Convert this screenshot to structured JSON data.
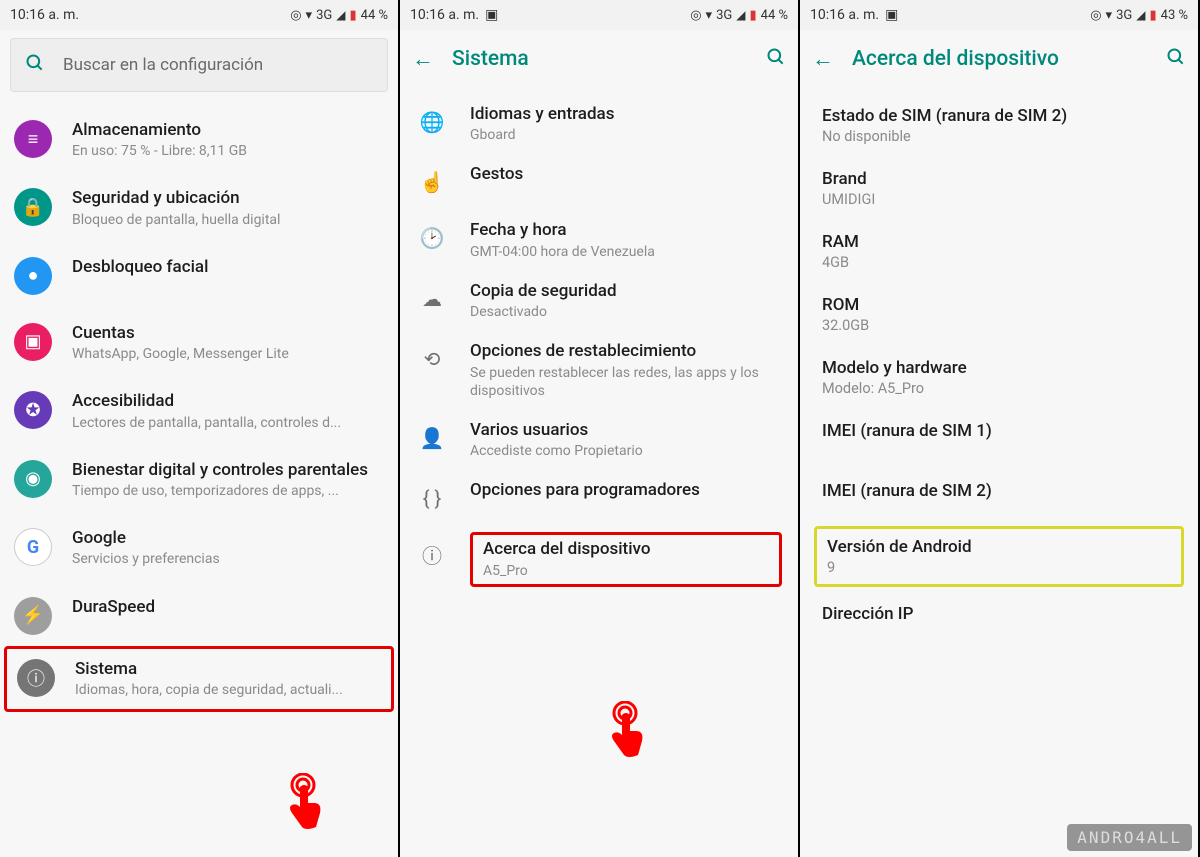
{
  "status": {
    "time1": "10:16 a. m.",
    "time2": "10:16 a. m.",
    "time3": "10:16 a. m.",
    "net": "3G",
    "batt1": "44 %",
    "batt2": "44 %",
    "batt3": "43 %"
  },
  "screen1": {
    "search_placeholder": "Buscar en la configuración",
    "items": [
      {
        "title": "Almacenamiento",
        "sub": "En uso: 75 % - Libre: 8,11 GB"
      },
      {
        "title": "Seguridad y ubicación",
        "sub": "Bloqueo de pantalla, huella digital"
      },
      {
        "title": "Desbloqueo facial",
        "sub": ""
      },
      {
        "title": "Cuentas",
        "sub": "WhatsApp, Google, Messenger Lite"
      },
      {
        "title": "Accesibilidad",
        "sub": "Lectores de pantalla, pantalla, controles d..."
      },
      {
        "title": "Bienestar digital y controles parentales",
        "sub": "Tiempo de uso, temporizadores de apps, ..."
      },
      {
        "title": "Google",
        "sub": "Servicios y preferencias"
      },
      {
        "title": "DuraSpeed",
        "sub": ""
      },
      {
        "title": "Sistema",
        "sub": "Idiomas, hora, copia de seguridad, actuali..."
      }
    ]
  },
  "screen2": {
    "header": "Sistema",
    "items": [
      {
        "title": "Idiomas y entradas",
        "sub": "Gboard"
      },
      {
        "title": "Gestos",
        "sub": ""
      },
      {
        "title": "Fecha y hora",
        "sub": "GMT-04:00 hora de Venezuela"
      },
      {
        "title": "Copia de seguridad",
        "sub": "Desactivado"
      },
      {
        "title": "Opciones de restablecimiento",
        "sub": "Se pueden restablecer las redes, las apps y los dispositivos"
      },
      {
        "title": "Varios usuarios",
        "sub": "Accediste como Propietario"
      },
      {
        "title": "Opciones para programadores",
        "sub": ""
      },
      {
        "title": "Acerca del dispositivo",
        "sub": "A5_Pro"
      }
    ]
  },
  "screen3": {
    "header": "Acerca del dispositivo",
    "items": [
      {
        "title": "Estado de SIM (ranura de SIM 2)",
        "sub": "No disponible"
      },
      {
        "title": "Brand",
        "sub": "UMIDIGI"
      },
      {
        "title": "RAM",
        "sub": "4GB"
      },
      {
        "title": "ROM",
        "sub": "32.0GB"
      },
      {
        "title": "Modelo y hardware",
        "sub": "Modelo: A5_Pro"
      },
      {
        "title": "IMEI (ranura de SIM 1)",
        "sub": ""
      },
      {
        "title": "IMEI (ranura de SIM 2)",
        "sub": ""
      },
      {
        "title": "Versión de Android",
        "sub": "9"
      },
      {
        "title": "Dirección IP",
        "sub": ""
      }
    ]
  },
  "watermark": "ANDRO4ALL"
}
